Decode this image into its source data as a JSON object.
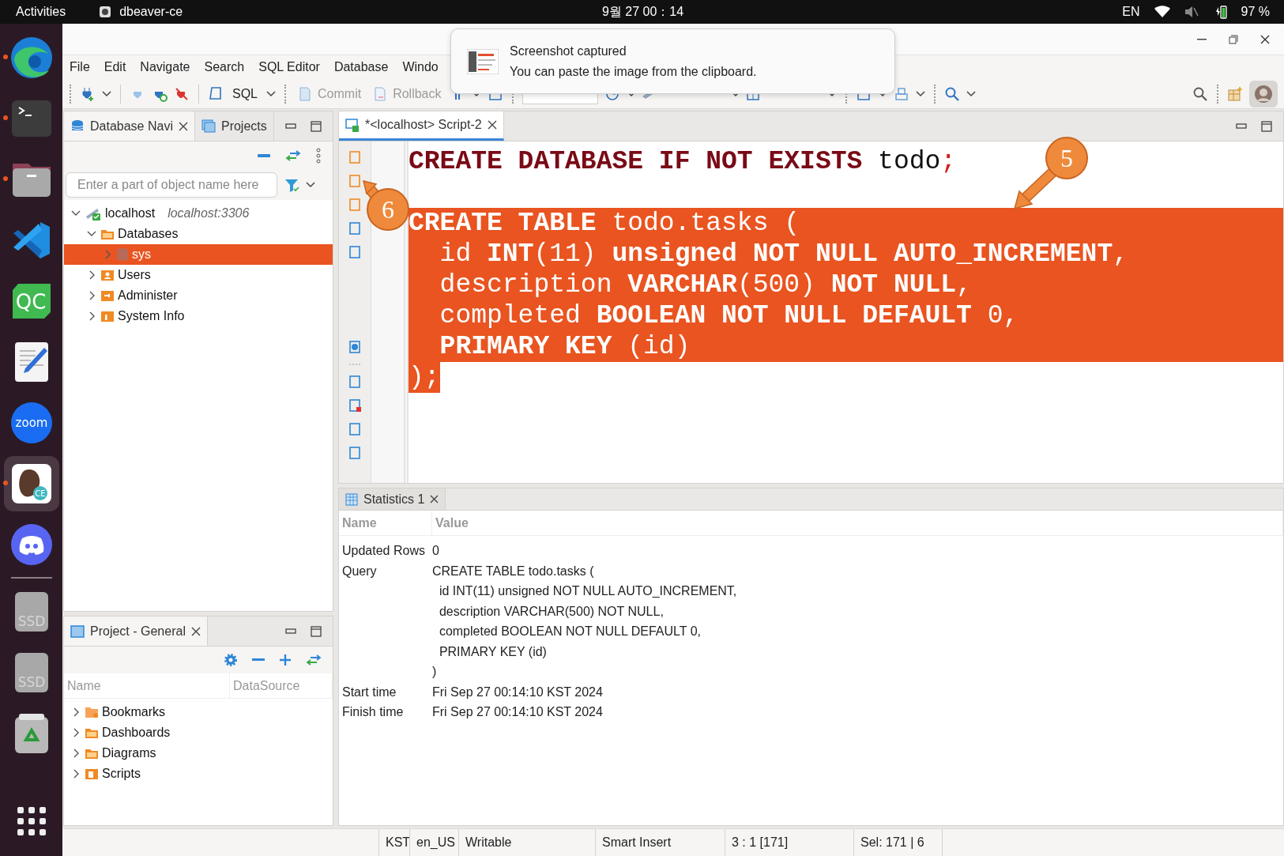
{
  "top_bar": {
    "activities": "Activities",
    "app": "dbeaver-ce",
    "clock": "9월 27  00：14",
    "input_source": "EN",
    "battery": "97 %"
  },
  "dock": [
    {
      "kind": "browser",
      "running": true,
      "selected": false
    },
    {
      "kind": "terminal",
      "running": true,
      "selected": false
    },
    {
      "kind": "files",
      "running": true,
      "selected": false
    },
    {
      "kind": "vscode",
      "running": false,
      "selected": false
    },
    {
      "kind": "qt",
      "label": "QC",
      "running": false,
      "selected": false
    },
    {
      "kind": "notes",
      "running": false,
      "selected": false
    },
    {
      "kind": "zoom",
      "label": "zoom",
      "running": false,
      "selected": false
    },
    {
      "kind": "dbeaver",
      "label": "CE",
      "running": true,
      "selected": true
    },
    {
      "kind": "discord",
      "running": false,
      "selected": false
    },
    {
      "kind": "separator"
    },
    {
      "kind": "drive",
      "label": "SSD",
      "running": false,
      "selected": false
    },
    {
      "kind": "drive",
      "label": "SSD",
      "running": false,
      "selected": false
    },
    {
      "kind": "trash",
      "running": false,
      "selected": false
    },
    {
      "kind": "apps",
      "running": false,
      "selected": false
    }
  ],
  "menu": [
    "File",
    "Edit",
    "Navigate",
    "Search",
    "SQL Editor",
    "Database",
    "Windo"
  ],
  "toolbar": {
    "sql": "SQL",
    "commit": {
      "label": "Commit",
      "disabled": true
    },
    "rollback": {
      "label": "Rollback",
      "disabled": true
    }
  },
  "notification": {
    "title": "Screenshot captured",
    "body": "You can paste the image from the clipboard."
  },
  "navigator": {
    "tabs": [
      {
        "label": "Database Navi",
        "selected": true,
        "closable": true
      },
      {
        "label": "Projects",
        "selected": false,
        "closable": false
      }
    ],
    "filter": {
      "placeholder": "Enter a part of object name here"
    },
    "tree": [
      {
        "label": "localhost",
        "detail": "localhost:3306",
        "kind": "connection",
        "expanded": true,
        "selected": false,
        "children": [
          {
            "label": "Databases",
            "kind": "databases",
            "expanded": true,
            "selected": false,
            "children": [
              {
                "label": "sys",
                "kind": "database",
                "expanded": false,
                "selected": true
              }
            ]
          },
          {
            "label": "Users",
            "kind": "users",
            "expanded": false,
            "selected": false
          },
          {
            "label": "Administer",
            "kind": "admin",
            "expanded": false,
            "selected": false
          },
          {
            "label": "System Info",
            "kind": "info",
            "expanded": false,
            "selected": false
          }
        ]
      }
    ]
  },
  "project": {
    "tab": "Project - General",
    "columns": [
      "Name",
      "DataSource"
    ],
    "rows": [
      {
        "label": "Bookmarks",
        "kind": "bookmarks",
        "expanded": false
      },
      {
        "label": "Dashboards",
        "kind": "dashboards",
        "expanded": false
      },
      {
        "label": "Diagrams",
        "kind": "diagrams",
        "expanded": false
      },
      {
        "label": "Scripts",
        "kind": "scripts",
        "expanded": false
      }
    ]
  },
  "editor": {
    "tab": "*<localhost> Script-2",
    "lines": [
      {
        "kind": "code",
        "selected": false,
        "tokens": [
          {
            "kind": "keyword",
            "text": "CREATE DATABASE IF NOT EXISTS"
          },
          {
            "kind": "plain",
            "text": " todo"
          },
          {
            "kind": "punct",
            "text": ";"
          }
        ]
      },
      {
        "kind": "blank"
      },
      {
        "kind": "code",
        "selected": true,
        "tokens": [
          {
            "kind": "keyword",
            "text": "CREATE TABLE"
          },
          {
            "kind": "plain",
            "text": " todo.tasks ("
          }
        ]
      },
      {
        "kind": "code",
        "selected": true,
        "tokens": [
          {
            "kind": "plain",
            "text": "  id "
          },
          {
            "kind": "keyword",
            "text": "INT"
          },
          {
            "kind": "plain",
            "text": "(11) "
          },
          {
            "kind": "keyword",
            "text": "unsigned NOT NULL AUTO_INCREMENT"
          },
          {
            "kind": "plain",
            "text": ","
          }
        ]
      },
      {
        "kind": "code",
        "selected": true,
        "tokens": [
          {
            "kind": "plain",
            "text": "  description "
          },
          {
            "kind": "keyword",
            "text": "VARCHAR"
          },
          {
            "kind": "plain",
            "text": "(500) "
          },
          {
            "kind": "keyword",
            "text": "NOT NULL"
          },
          {
            "kind": "plain",
            "text": ","
          }
        ]
      },
      {
        "kind": "code",
        "selected": true,
        "tokens": [
          {
            "kind": "plain",
            "text": "  completed "
          },
          {
            "kind": "keyword",
            "text": "BOOLEAN NOT NULL DEFAULT"
          },
          {
            "kind": "plain",
            "text": " 0,"
          }
        ]
      },
      {
        "kind": "code",
        "selected": true,
        "tokens": [
          {
            "kind": "keyword",
            "text": "  PRIMARY KEY"
          },
          {
            "kind": "plain",
            "text": " (id)"
          }
        ]
      },
      {
        "kind": "code",
        "selected": true,
        "tokens": [
          {
            "kind": "plain",
            "text": ");"
          }
        ]
      }
    ],
    "annotations": [
      {
        "label": "5"
      },
      {
        "label": "6"
      }
    ]
  },
  "stats": {
    "tab": "Statistics 1",
    "columns": [
      "Name",
      "Value"
    ],
    "rows": [
      {
        "name": "Updated Rows",
        "value": "0"
      },
      {
        "name": "Query",
        "value": "CREATE TABLE todo.tasks (\n  id INT(11) unsigned NOT NULL AUTO_INCREMENT,\n  description VARCHAR(500) NOT NULL,\n  completed BOOLEAN NOT NULL DEFAULT 0,\n  PRIMARY KEY (id)\n)"
      },
      {
        "name": "Start time",
        "value": "Fri Sep 27 00:14:10 KST 2024"
      },
      {
        "name": "Finish time",
        "value": "Fri Sep 27 00:14:10 KST 2024"
      }
    ]
  },
  "status_bar": [
    "KST",
    "en_US",
    "Writable",
    "Smart Insert",
    "3 : 1 [171]",
    "Sel: 171 | 6"
  ]
}
